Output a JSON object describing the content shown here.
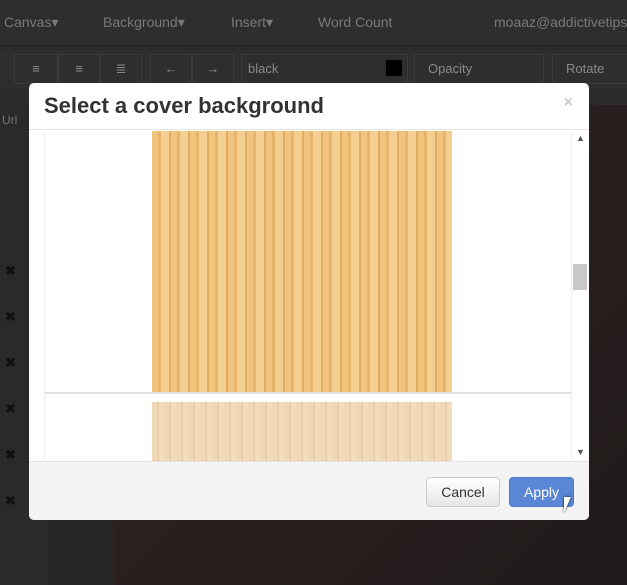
{
  "nav": {
    "items": [
      "Canvas▾",
      "Background▾",
      "Insert▾",
      "Word Count"
    ],
    "user": "moaaz@addictivetips"
  },
  "toolbar": {
    "color_value": "black",
    "opacity_label": "Opacity",
    "rotate_label": "Rotate",
    "side_label": "Url"
  },
  "modal": {
    "title": "Select a cover background",
    "close": "×",
    "cancel": "Cancel",
    "apply": "Apply"
  },
  "sidebar": {
    "remove_icon": "✖"
  }
}
